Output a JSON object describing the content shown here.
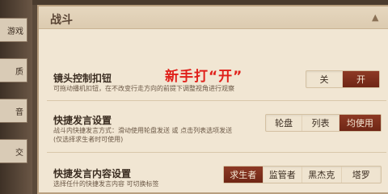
{
  "left_tabs": [
    {
      "label": "游戏"
    },
    {
      "label": "质"
    },
    {
      "label": "音"
    },
    {
      "label": "交"
    }
  ],
  "section": {
    "title": "战斗"
  },
  "rows": [
    {
      "title": "镜头控制扣钮",
      "desc": "可拖动播机扣钮，在不改变行走方向的前提下调整视角进行观察",
      "options": [
        "关",
        "开"
      ],
      "selected": "开"
    },
    {
      "title": "快捷发言设置",
      "desc_line1": "战斗内快捷发言方式：滑动使用轮盘发送 或 点击列表选项发送",
      "desc_line2": "(仅选择求生者时可使用)",
      "options": [
        "轮盘",
        "列表",
        "均使用"
      ],
      "selected": "均使用"
    },
    {
      "title": "快捷发言内容设置",
      "desc": "选择任什的快捷发言内容  可切换标签",
      "options": [
        "求生者",
        "监管者",
        "黑杰克",
        "塔罗"
      ],
      "selected": "求生者"
    }
  ],
  "annotation": "新手打“开”",
  "colors": {
    "panel_bg": "#f1e6d3",
    "active_option": "#7f3220",
    "annotation_red": "#e0201a"
  }
}
